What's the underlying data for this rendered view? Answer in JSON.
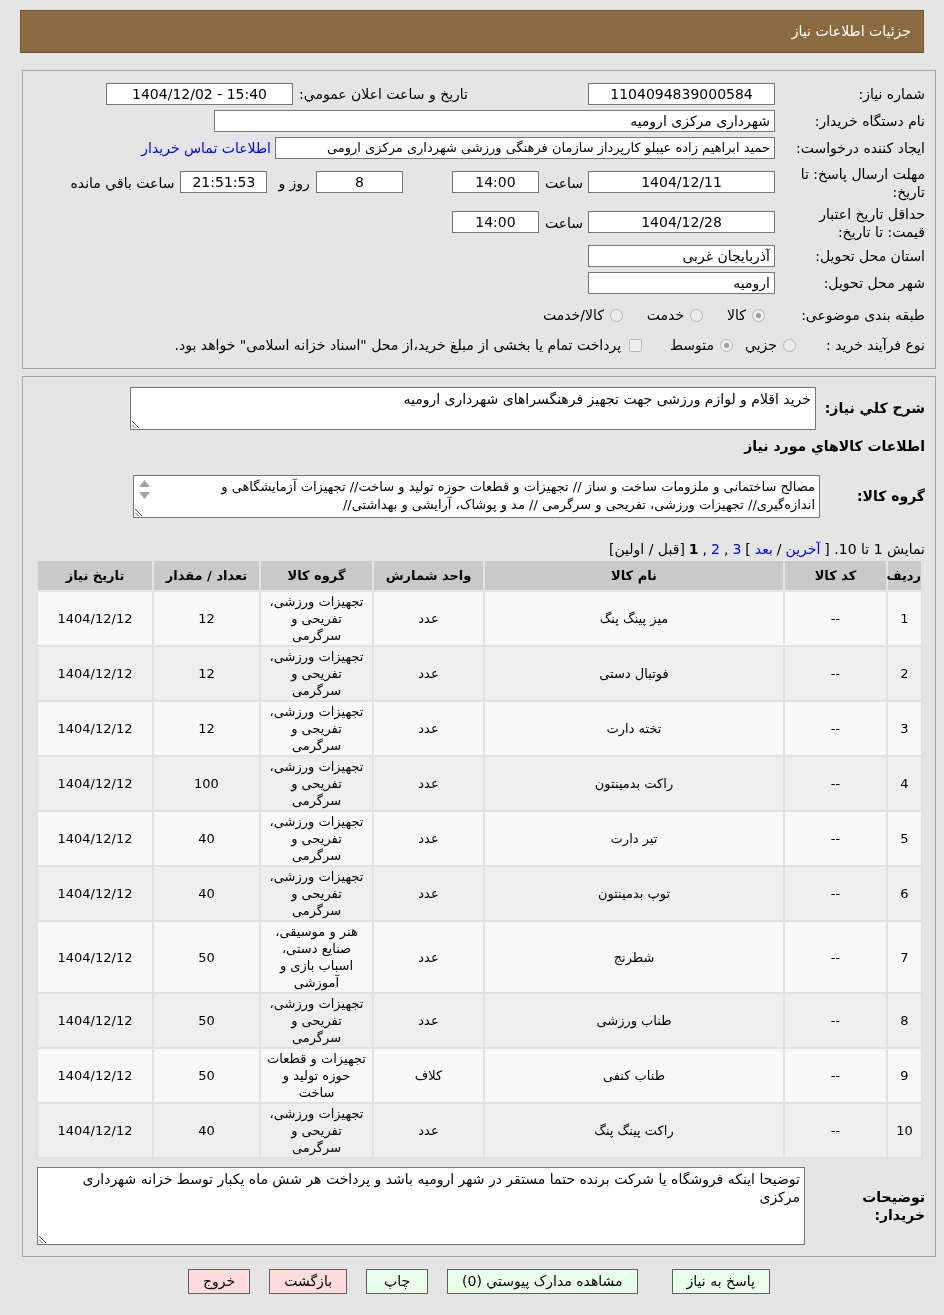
{
  "header": {
    "title": "جزئیات اطلاعات نیاز"
  },
  "details": {
    "need_number": {
      "label": "شماره نیاز:",
      "value": "1104094839000584"
    },
    "announcement": {
      "label": "تاریخ و ساعت اعلان عمومي:",
      "value": "1404/12/02 - 15:40"
    },
    "buyer_organization": {
      "label": "نام دستگاه خريدار:",
      "value": "شهرداری مرکزی ارومیه"
    },
    "requester": {
      "label": "ایجاد کننده درخواست:",
      "value": "حمید ابراهیم زاده عیبلو کارپرداز سازمان فرهنگی ورزشی شهرداری مرکزی ارومی",
      "contact_link": "اطلاعات تماس خريدار"
    },
    "reply_deadline": {
      "label": "مهلت ارسال پاسخ: تا تاریخ:",
      "date": "1404/12/11",
      "time_label": "ساعت",
      "time": "14:00",
      "days": "8",
      "days_label": "روز و",
      "remaining": "21:51:53",
      "remaining_label": "ساعت باقي مانده"
    },
    "price_validity": {
      "label": "حداقل تاریخ اعتبار قیمت: تا تاریخ:",
      "date": "1404/12/28",
      "time_label": "ساعت",
      "time": "14:00"
    },
    "delivery_province": {
      "label": "استان محل تحویل:",
      "value": "آذربایجان غربی"
    },
    "delivery_city": {
      "label": "شهر محل تحویل:",
      "value": "ارومیه"
    },
    "subject_category": {
      "label": "طبقه بندی موضوعی:",
      "options": [
        {
          "label": "کالا",
          "selected": true
        },
        {
          "label": "خدمت",
          "selected": false
        },
        {
          "label": "کالا/خدمت",
          "selected": false
        }
      ]
    },
    "purchase_process": {
      "label": "نوع فرآیند خرید :",
      "options": [
        {
          "label": "جزيي",
          "selected": false
        },
        {
          "label": "متوسط",
          "selected": true
        }
      ],
      "treasury_payment": {
        "label": "پرداخت تمام یا بخشی از مبلغ خرید،از محل \"اسناد خزانه اسلامی\" خواهد بود.",
        "checked": false
      }
    }
  },
  "need": {
    "description_label": "شرح کلي نیاز:",
    "description": "خرید اقلام و لوازم ورزشی جهت تجهیز فرهنگسراهای شهرداری ارومیه",
    "goods_heading": "اطلاعات کالاهاي مورد نیاز",
    "goods_group_label": "گروه کالا:",
    "goods_group": "مصالح ساختمانی و ملزومات ساخت و ساز // تجهیزات و قطعات حوزه تولید و ساخت// تجهیزات آزمایشگاهی و اندازه‌گیری// تجهیزات ورزشی، تفریحی و سرگرمی // مد و پوشاک، آرایشی و بهداشتی//",
    "pagination": [
      {
        "kind": "text",
        "text": "نمایش 1 تا 10. ["
      },
      {
        "kind": "link",
        "text": "آخرین"
      },
      {
        "kind": "text",
        "text": "/"
      },
      {
        "kind": "link",
        "text": "بعد"
      },
      {
        "kind": "text",
        "text": "]"
      },
      {
        "kind": "link",
        "text": "3"
      },
      {
        "kind": "text",
        "text": ","
      },
      {
        "kind": "link",
        "text": "2"
      },
      {
        "kind": "text",
        "text": ","
      },
      {
        "kind": "current",
        "text": "1"
      },
      {
        "kind": "text",
        "text": "[قبل / اولین]"
      }
    ],
    "table": {
      "columns": [
        "ردیف",
        "کد کالا",
        "نام کالا",
        "واحد شمارش",
        "گروه کالا",
        "تعداد / مقدار",
        "تاریخ نیاز"
      ],
      "rows": [
        [
          "1",
          "--",
          "میز پینگ پنگ",
          "عدد",
          "تجهیزات ورزشی، تفریحی و سرگرمی",
          "12",
          "1404/12/12"
        ],
        [
          "2",
          "--",
          "فوتبال دستی",
          "عدد",
          "تجهیزات ورزشی، تفریحی و سرگرمی",
          "12",
          "1404/12/12"
        ],
        [
          "3",
          "--",
          "تخته دارت",
          "عدد",
          "تجهیزات ورزشی، تفریحی و سرگرمی",
          "12",
          "1404/12/12"
        ],
        [
          "4",
          "--",
          "راکت بدمینتون",
          "عدد",
          "تجهیزات ورزشی، تفریحی و سرگرمی",
          "100",
          "1404/12/12"
        ],
        [
          "5",
          "--",
          "تیر دارت",
          "عدد",
          "تجهیزات ورزشی، تفریحی و سرگرمی",
          "40",
          "1404/12/12"
        ],
        [
          "6",
          "--",
          "توپ بدمینتون",
          "عدد",
          "تجهیزات ورزشی، تفریحی و سرگرمی",
          "40",
          "1404/12/12"
        ],
        [
          "7",
          "--",
          "شطرنج",
          "عدد",
          "هنر و موسیقی، صنایع دستی، اسباب بازی و آموزشی",
          "50",
          "1404/12/12"
        ],
        [
          "8",
          "--",
          "طناب ورزشی",
          "عدد",
          "تجهیزات ورزشی، تفریحی و سرگرمی",
          "50",
          "1404/12/12"
        ],
        [
          "9",
          "--",
          "طناب کنفی",
          "کلاف",
          "تجهیزات و قطعات حوزه تولید و ساخت",
          "50",
          "1404/12/12"
        ],
        [
          "10",
          "--",
          "راکت پینگ پنگ",
          "عدد",
          "تجهیزات ورزشی، تفریحی و سرگرمی",
          "40",
          "1404/12/12"
        ]
      ]
    },
    "buyer_notes_label": "توضیحات خریدار:",
    "buyer_notes": "توضیحا اینکه فروشگاه یا شرکت برنده حتما مستقر در شهر ارومیه باشد و پرداخت هر شش ماه یکبار توسط خزانه شهرداری مرکزی"
  },
  "buttons": [
    {
      "label": "پاسخ به نیاز",
      "kind": "action"
    },
    {
      "label": "مشاهده مدارک پیوستي (0)",
      "kind": "action"
    },
    {
      "label": "چاپ",
      "kind": "action"
    },
    {
      "label": "بازگشت",
      "kind": "exit"
    },
    {
      "label": "خروج",
      "kind": "exit"
    }
  ]
}
